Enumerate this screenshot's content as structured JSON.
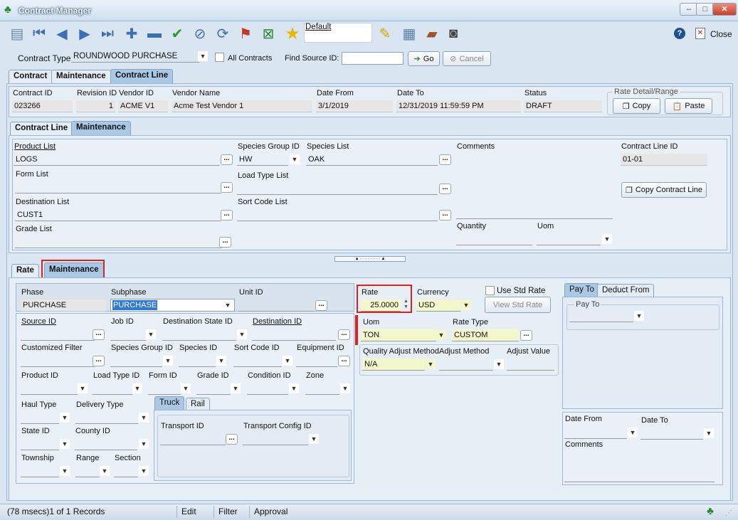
{
  "window": {
    "title": "Contract Manager",
    "close_label": "Close"
  },
  "toolbar": {
    "view_name": "Default"
  },
  "search": {
    "contract_type_label": "Contract Type",
    "contract_type_value": "ROUNDWOOD PURCHASE",
    "all_contracts_label": "All Contracts",
    "find_source_label": "Find Source ID:",
    "find_source_value": "",
    "go_label": "Go",
    "cancel_label": "Cancel"
  },
  "top_tabs": [
    "Contract",
    "Maintenance",
    "Contract Line"
  ],
  "header": {
    "contract_id_label": "Contract ID",
    "contract_id": "023266",
    "revision_label": "Revision ID",
    "revision": "1",
    "vendor_id_label": "Vendor ID",
    "vendor_id": "ACME V1",
    "vendor_name_label": "Vendor Name",
    "vendor_name": "Acme Test Vendor 1",
    "date_from_label": "Date From",
    "date_from": "3/1/2019",
    "date_to_label": "Date To",
    "date_to": "12/31/2019 11:59:59 PM",
    "status_label": "Status",
    "status": "DRAFT",
    "rate_detail_label": "Rate Detail/Range",
    "copy_label": "Copy",
    "paste_label": "Paste"
  },
  "line_tabs": [
    "Contract Line",
    "Maintenance"
  ],
  "line": {
    "product_list_label": "Product List",
    "product_list": "LOGS",
    "species_group_label": "Species Group ID",
    "species_group": "HW",
    "species_list_label": "Species List",
    "species_list": "OAK",
    "comments_label": "Comments",
    "line_id_label": "Contract Line ID",
    "line_id": "01-01",
    "form_list_label": "Form List",
    "load_type_label": "Load Type List",
    "copy_line_label": "Copy Contract Line",
    "destination_label": "Destination List",
    "destination": "CUST1",
    "sort_code_label": "Sort Code List",
    "grade_label": "Grade List",
    "quantity_label": "Quantity",
    "uom_label": "Uom"
  },
  "rate_tabs": [
    "Rate",
    "Maintenance"
  ],
  "rate": {
    "phase_label": "Phase",
    "phase": "PURCHASE",
    "subphase_label": "Subphase",
    "subphase": "PURCHASE",
    "unit_id_label": "Unit ID",
    "rate_label": "Rate",
    "rate": "25.0000",
    "currency_label": "Currency",
    "currency": "USD",
    "use_std_label": "Use Std Rate",
    "view_std_label": "View Std Rate",
    "source_id_label": "Source ID",
    "job_id_label": "Job ID",
    "dest_state_label": "Destination State ID",
    "dest_id_label": "Destination ID",
    "uom_label": "Uom",
    "uom": "TON",
    "rate_type_label": "Rate Type",
    "rate_type": "CUSTOM",
    "custom_filter_label": "Customized Filter",
    "species_group_label": "Species Group ID",
    "species_id_label": "Species ID",
    "sort_code_label": "Sort Code ID",
    "equipment_label": "Equipment ID",
    "qam_label": "Quality Adjust Method",
    "am_label": "Adjust Method",
    "av_label": "Adjust Value",
    "qam_value": "N/A",
    "product_id_label": "Product ID",
    "load_type_label": "Load Type ID",
    "form_id_label": "Form ID",
    "grade_id_label": "Grade ID",
    "condition_label": "Condition ID",
    "zone_label": "Zone",
    "haul_type_label": "Haul Type",
    "delivery_type_label": "Delivery Type",
    "state_label": "State ID",
    "county_label": "County ID",
    "township_label": "Township",
    "range_label": "Range",
    "section_label": "Section",
    "transport_tabs": [
      "Truck",
      "Rail"
    ],
    "transport_id_label": "Transport ID",
    "transport_config_label": "Transport Config ID"
  },
  "pay_tabs": [
    "Pay To",
    "Deduct From"
  ],
  "pay": {
    "pay_to_label": "Pay To",
    "date_from_label": "Date From",
    "date_to_label": "Date To",
    "comments_label": "Comments"
  },
  "status": {
    "records": "(78 msecs)1 of 1 Records",
    "edit": "Edit",
    "filter": "Filter",
    "approval": "Approval"
  }
}
